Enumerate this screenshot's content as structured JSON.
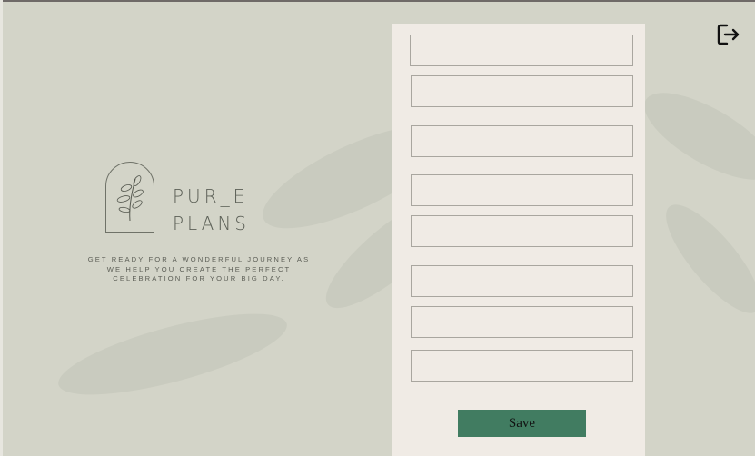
{
  "brand": {
    "line1": "PUR_E",
    "line2": "PLANS"
  },
  "tagline": "GET READY FOR A WONDERFUL JOURNEY AS WE HELP YOU CREATE THE PERFECT CELEBRATION FOR YOUR BIG DAY.",
  "form": {
    "fields": [
      {
        "value": "",
        "placeholder": ""
      },
      {
        "value": "",
        "placeholder": ""
      },
      {
        "value": "",
        "placeholder": ""
      },
      {
        "value": "",
        "placeholder": ""
      },
      {
        "value": "",
        "placeholder": ""
      },
      {
        "value": "",
        "placeholder": ""
      },
      {
        "value": "",
        "placeholder": ""
      },
      {
        "value": "",
        "placeholder": ""
      }
    ],
    "save_label": "Save"
  },
  "icons": {
    "logout": "logout-icon",
    "brand": "leaf-branch-icon"
  },
  "colors": {
    "background": "#d3d4c8",
    "panel": "#f0ebe5",
    "accent": "#417c61"
  }
}
